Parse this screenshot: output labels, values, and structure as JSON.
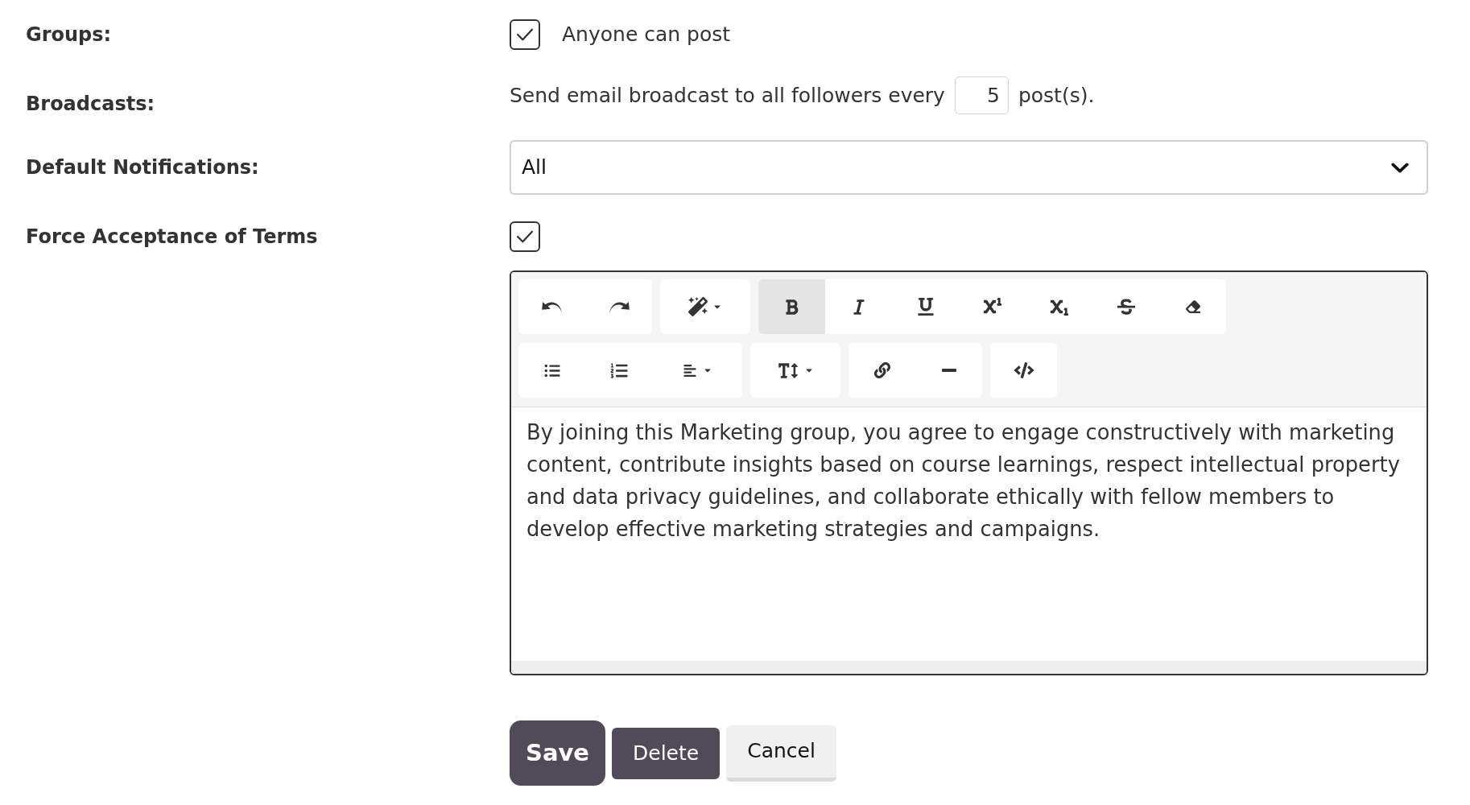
{
  "settings": [
    {
      "kind": "checkbox",
      "label": "Groups:",
      "checked": true,
      "text": "Anyone can post"
    },
    {
      "kind": "number",
      "label": "Broadcasts:",
      "text_before": "Send email broadcast to all followers every",
      "value": "5",
      "text_after": "post(s)."
    },
    {
      "kind": "select",
      "label": "Default Notifications:",
      "value": "All"
    },
    {
      "kind": "checkbox",
      "label": "Force Acceptance of Terms",
      "checked": true
    }
  ],
  "editor": {
    "toolbar": [
      [
        [
          {
            "kind": "undo",
            "active": false,
            "dropdown": false
          },
          {
            "kind": "redo",
            "active": false,
            "dropdown": false
          }
        ],
        [
          {
            "kind": "style",
            "active": false,
            "dropdown": true
          }
        ],
        [
          {
            "kind": "bold",
            "active": true,
            "dropdown": false
          },
          {
            "kind": "italic",
            "active": false,
            "dropdown": false
          },
          {
            "kind": "underline",
            "active": false,
            "dropdown": false
          },
          {
            "kind": "superscript",
            "active": false,
            "dropdown": false
          },
          {
            "kind": "subscript",
            "active": false,
            "dropdown": false
          },
          {
            "kind": "strikethrough",
            "active": false,
            "dropdown": false
          },
          {
            "kind": "clear-format",
            "active": false,
            "dropdown": false
          }
        ]
      ],
      [
        [
          {
            "kind": "bullet-list",
            "active": false,
            "dropdown": false
          },
          {
            "kind": "numbered-list",
            "active": false,
            "dropdown": false
          },
          {
            "kind": "align",
            "active": false,
            "dropdown": true
          }
        ],
        [
          {
            "kind": "font-size",
            "active": false,
            "dropdown": true
          }
        ],
        [
          {
            "kind": "link",
            "active": false,
            "dropdown": false
          },
          {
            "kind": "horizontal-rule",
            "active": false,
            "dropdown": false
          }
        ],
        [
          {
            "kind": "code-view",
            "active": false,
            "dropdown": false
          }
        ]
      ]
    ],
    "content": "By joining this Marketing group, you agree to engage constructively with marketing content, contribute insights based on course learnings, respect intellectual property and data privacy guidelines, and collaborate ethically with fellow members to develop effective marketing strategies and campaigns."
  },
  "buttons": [
    {
      "kind": "primary-large",
      "label": "Save"
    },
    {
      "kind": "primary",
      "label": "Delete"
    },
    {
      "kind": "secondary",
      "label": "Cancel"
    }
  ]
}
